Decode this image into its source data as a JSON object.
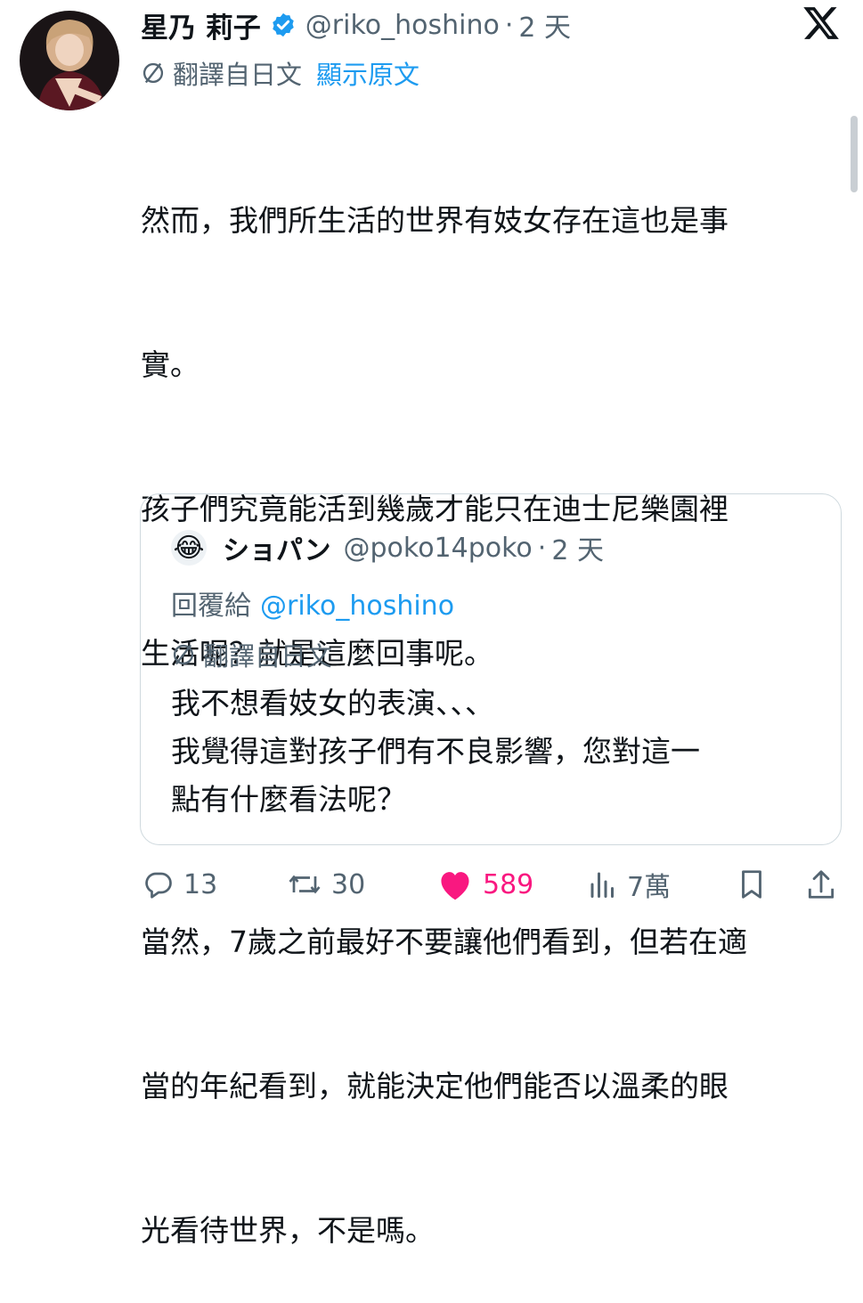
{
  "tweet": {
    "author_name": "星乃 莉子",
    "handle": "@riko_hoshino",
    "separator": "·",
    "time": "2 天",
    "translated_from": "翻譯自日文",
    "show_original": "顯示原文",
    "text_lines": [
      "然而，我們所生活的世界有妓女存在這也是事",
      "實。",
      "孩子們究竟能活到幾歲才能只在迪士尼樂園裡",
      "生活呢？就是這麼回事呢。",
      "",
      "當然，7歲之前最好不要讓他們看到，但若在適",
      "當的年紀看到，就能決定他們能否以溫柔的眼",
      "光看待世界，不是嗎。"
    ]
  },
  "quote": {
    "avatar_emoji": "😂",
    "author_name": "ショパン",
    "handle": "@poko14poko",
    "separator": "·",
    "time": "2 天",
    "reply_prefix": "回覆給",
    "reply_to": "@riko_hoshino",
    "translated_from": "翻譯自日文",
    "text_lines": [
      "我不想看妓女的表演、、、",
      "我覺得這對孩子們有不良影響，您對這一",
      "點有什麼看法呢？"
    ]
  },
  "actions": {
    "replies": "13",
    "reposts": "30",
    "likes": "589",
    "views": "7萬"
  },
  "colors": {
    "text": "#0f1419",
    "secondary": "#536471",
    "link": "#1d9bf0",
    "like": "#f91880",
    "verified": "#1d9bf0",
    "border": "#cfd9de"
  },
  "icons": [
    "verified-badge-icon",
    "x-logo-icon",
    "translate-icon",
    "reply-icon",
    "repost-icon",
    "like-icon",
    "views-icon",
    "bookmark-icon",
    "share-icon"
  ]
}
